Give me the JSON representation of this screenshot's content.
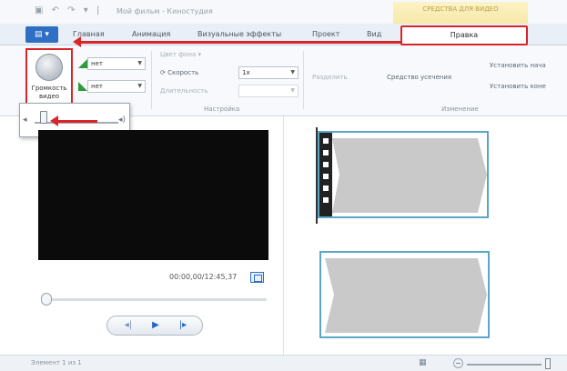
{
  "window": {
    "quick_access": "▣ ↶ ↷ ▾ |",
    "title": "Мой фильм - Киностудия",
    "contextual_group": "СРЕДСТВА ДЛЯ ВИДЕО"
  },
  "tabs": {
    "file": "▤ ▾",
    "items": [
      "Главная",
      "Анимация",
      "Визуальные эффекты",
      "Проект",
      "Вид"
    ],
    "active": "Правка"
  },
  "ribbon": {
    "volume_label": "Громкость видео",
    "fade_in_value": "нет",
    "fade_out_value": "нет",
    "bg_color": "Цвет фона ▾",
    "speed_label": "Скорость",
    "speed_value": "1x",
    "duration_label": "Длительность",
    "split": "Разделить",
    "trim": "Средство усечения",
    "set_start": "Установить нача",
    "set_end": "Установить коне",
    "group_settings": "Настройка",
    "group_editing": "Изменение"
  },
  "player": {
    "timecode": "00:00,00/12:45,37",
    "prev_icon": "◂|",
    "play_icon": "▶",
    "next_icon": "|▸"
  },
  "status": {
    "text": "Элемент 1 из 1"
  },
  "colors": {
    "annotation_red": "#d9252a",
    "accent_blue": "#2e6fc4",
    "clip_border": "#5aa6c7"
  },
  "icons": [
    "fade-in-icon",
    "fade-out-icon",
    "volume-icon",
    "speaker-icon",
    "speed-icon",
    "fullscreen-icon",
    "play-icon",
    "zoom-icon"
  ]
}
